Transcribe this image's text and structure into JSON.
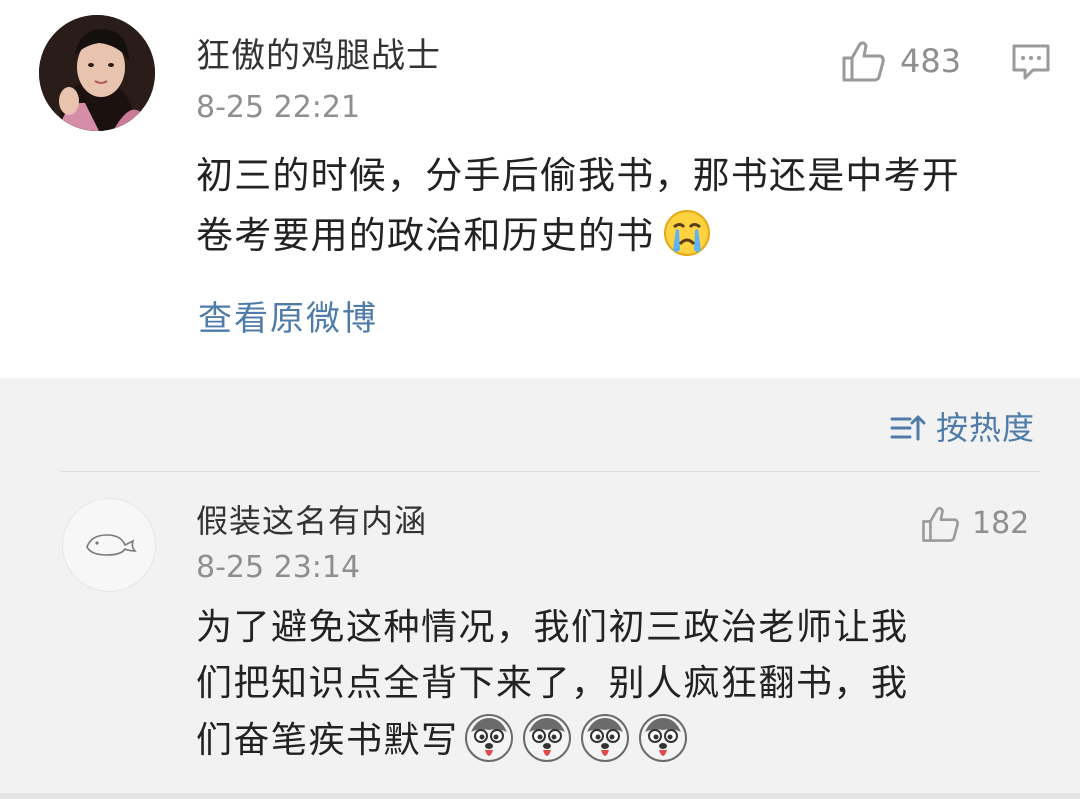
{
  "post": {
    "username": "狂傲的鸡腿战士",
    "time": "8-25 22:21",
    "likes": "483",
    "body_lines": [
      "初三的时候，分手后偷我书，那书还是中考开",
      "卷考要用的政治和历史的书"
    ],
    "body_emoji": "crying-face",
    "view_original": "查看原微博",
    "icons": {
      "like": "thumbs-up-icon",
      "comment": "comment-icon"
    }
  },
  "comments": {
    "sort_label": "按热度",
    "sort_icon": "sort-icon",
    "items": [
      {
        "username": "假装这名有内涵",
        "time": "8-25 23:14",
        "likes": "182",
        "body_lines": [
          "为了避免这种情况，我们初三政治老师让我",
          "们把知识点全背下来了，别人疯狂翻书，我",
          "们奋笔疾书默写"
        ],
        "emoji_count": 4,
        "emoji": "husky-tongue-face"
      }
    ]
  },
  "colors": {
    "link": "#4f7ca8",
    "text": "#222222",
    "muted": "#8f8f8f",
    "section_bg": "#f2f2f2"
  }
}
